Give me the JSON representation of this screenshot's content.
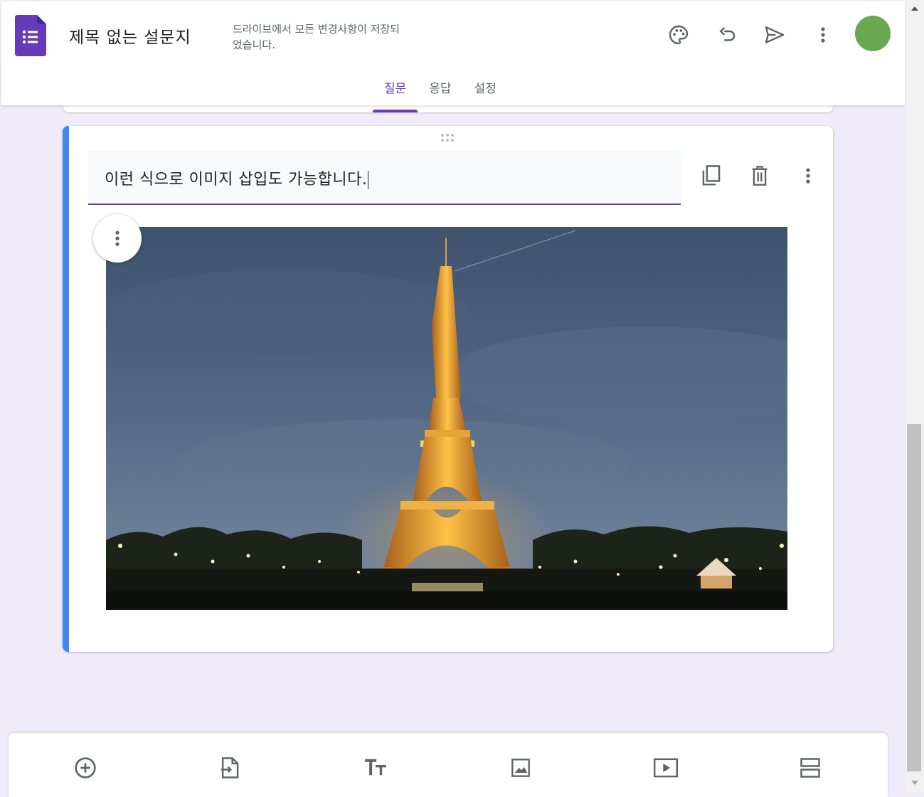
{
  "header": {
    "doc_title": "제목 없는 설문지",
    "save_status": "드라이브에서 모든 변경사항이 저장되었습니다.",
    "icons": [
      "palette-icon",
      "undo-icon",
      "send-icon",
      "more-vert-icon"
    ],
    "tabs": [
      {
        "label": "질문",
        "active": true
      },
      {
        "label": "응답",
        "active": false
      },
      {
        "label": "설정",
        "active": false
      }
    ]
  },
  "question_card": {
    "title_value": "이런 식으로 이미지 삽입도 가능합니다.",
    "accent_color": "#4285f4",
    "actions": [
      "copy-icon",
      "delete-icon",
      "more-vert-icon"
    ],
    "image": "eiffel-tower-at-night"
  },
  "toolbar": {
    "tools": [
      "add-question-icon",
      "import-questions-icon",
      "add-title-icon",
      "add-image-icon",
      "add-video-icon",
      "add-section-icon"
    ]
  },
  "colors": {
    "brand": "#673ab7",
    "avatar": "#6aa84f",
    "background": "#efebf8"
  }
}
